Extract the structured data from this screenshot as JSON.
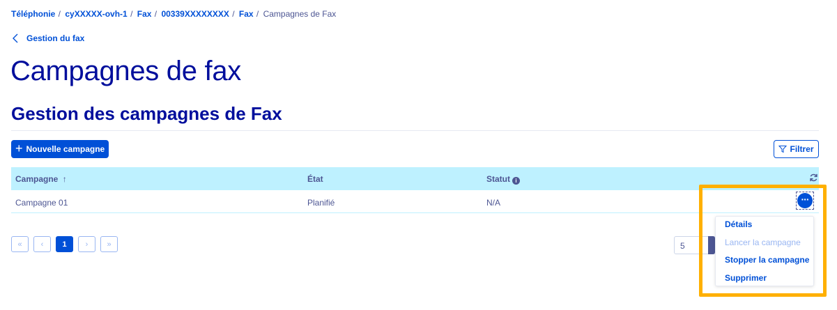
{
  "breadcrumb": {
    "items": [
      "Téléphonie",
      "cyXXXXX-ovh-1",
      "Fax",
      "00339XXXXXXXX",
      "Fax"
    ],
    "current": "Campagnes de Fax"
  },
  "back_link": {
    "label": "Gestion du fax",
    "icon": "chevron-left-icon"
  },
  "page_title": "Campagnes de fax",
  "section_title": "Gestion des campagnes de Fax",
  "toolbar": {
    "new_campaign_label": "Nouvelle campagne",
    "filter_label": "Filtrer"
  },
  "table": {
    "columns": {
      "campaign": "Campagne",
      "sort_indicator": "↑",
      "state": "État",
      "status": "Statut"
    },
    "rows": [
      {
        "campaign": "Campagne 01",
        "state": "Planifié",
        "status": "N/A"
      }
    ]
  },
  "pagination": {
    "first": "«",
    "prev": "‹",
    "current": "1",
    "next": "›",
    "last": "»",
    "page_size": "5"
  },
  "actions_menu": {
    "items": [
      {
        "label": "Détails",
        "enabled": true
      },
      {
        "label": "Lancer la campagne",
        "enabled": false
      },
      {
        "label": "Stopper la campagne",
        "enabled": true
      },
      {
        "label": "Supprimer",
        "enabled": true
      }
    ]
  },
  "colors": {
    "primary": "#0050d7",
    "heading": "#000e9c",
    "text": "#4d5693",
    "table_header_bg": "#bef1ff",
    "highlight": "#ffb000"
  }
}
